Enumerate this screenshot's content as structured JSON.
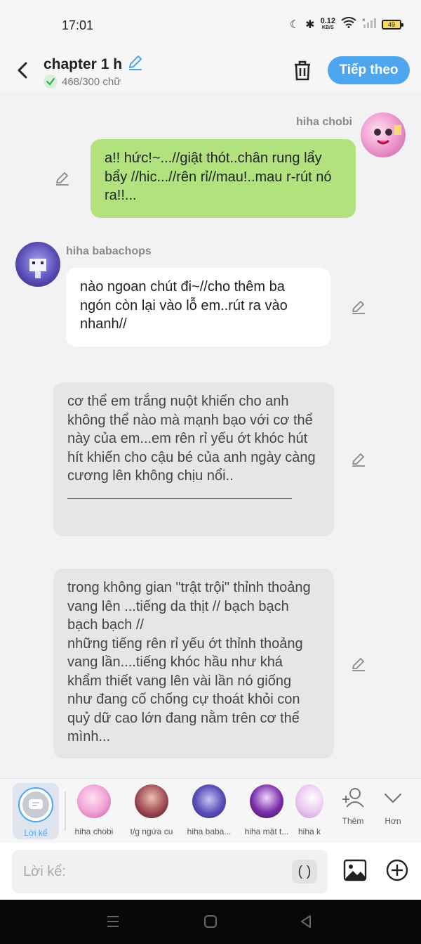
{
  "status": {
    "time": "17:01",
    "net_speed": "0.12",
    "net_unit": "KB/S",
    "battery": "49"
  },
  "header": {
    "title": "chapter 1 h",
    "word_count": "468/300 chữ",
    "next_label": "Tiếp theo"
  },
  "messages": [
    {
      "sender": "hiha chobi",
      "text": "a!! hức!~...//giật thót..chân rung lẩy bẩy //hic...//rên rỉ//mau!..mau r-rút nó ra!!..."
    },
    {
      "sender": "hiha babachops",
      "text": "nào ngoan chút đi~//cho thêm ba ngón còn lại vào lỗ em..rút ra vào nhanh//"
    },
    {
      "text": "cơ thể em trắng nuột khiến cho anh không thể nào mà mạnh bạo với cơ thể này của em...em rên rỉ yếu ớt khóc hút hít khiến cho cậu bé của anh ngày càng cương lên không chịu nổi.."
    },
    {
      "text": "trong không gian \"trật trội\" thỉnh thoảng vang lên ...tiếng da thịt // bạch bạch bạch bạch //\nnhững tiếng rên rỉ yếu ớt thỉnh thoảng vang  lần....tiếng khóc hầu như khá khẩm thiết vang lên vài lần nó giống như đang cố chống cự thoát khỏi con quỷ dữ cao lớn đang nằm trên cơ thể mình..."
    }
  ],
  "charbar": {
    "narrator_label": "Lời kể",
    "characters": [
      {
        "label": "hiha chobi",
        "color": "#f3a6d6"
      },
      {
        "label": "t/g ngứa cu",
        "color": "#a14a55"
      },
      {
        "label": "hiha baba...",
        "color": "#5b4fb8"
      },
      {
        "label": "hiha mặt t...",
        "color": "#7a2fa8"
      },
      {
        "label": "hiha k",
        "color": "#e7c2ee"
      }
    ],
    "add_label": "Thêm",
    "more_label": "Hơn"
  },
  "input": {
    "placeholder": "Lời kể:",
    "paren": "( )"
  }
}
